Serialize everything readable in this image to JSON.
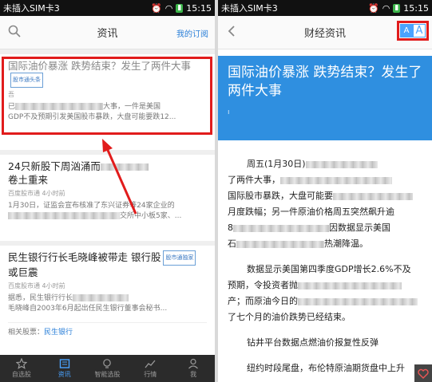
{
  "left": {
    "status": {
      "carrier": "未插入SIM卡3",
      "time": "15:15"
    },
    "header": {
      "title": "资讯",
      "subscribe_link": "我的订阅"
    },
    "articles": [
      {
        "title": "国际油价暴涨 跌势结束？发生了两件大事",
        "tag": "股市通头条",
        "meta": "吾",
        "summary_start": "已",
        "summary_mid": "大事，一件是美国",
        "summary_line2": "GDP不及预期引发美国股市暴跌，大盘可能要跌12..."
      },
      {
        "title_line1": "24只新股下周汹涌而",
        "title_line2": "卷土重来",
        "meta": "百度股市通  4小时前",
        "summary_line1": "1月30日，证监会宣布核准了东兴证券等24家企业的",
        "summary_line2": "交所中小板5家、..."
      },
      {
        "title_line1": "民生银行行长毛晓峰被带走 银行股",
        "tag": "股市通独家",
        "title_line2": "或巨震",
        "meta": "百度股市通  4小时前",
        "summary_line1": "据悉，民生银行行长",
        "summary_line2": "毛晓峰自2003年6月起出任民生银行董事会秘书...",
        "related_label": "相关股票：",
        "related_value": "民生银行"
      }
    ],
    "tabs": [
      "自选股",
      "资讯",
      "智能选股",
      "行情",
      "我"
    ]
  },
  "right": {
    "status": {
      "carrier": "未插入SIM卡3",
      "time": "15:15"
    },
    "header": {
      "title": "财经资讯"
    },
    "font_buttons": {
      "small": "A",
      "big": "A"
    },
    "article": {
      "title": "国际油价暴涨 跌势结束？发生了两件大事",
      "paragraphs": [
        {
          "start": "周五(1月30日)",
          "line2": "了两件大事，",
          "line3": "国际股市暴跌，大盘可能要",
          "line4": "月度跌幅；另一件原油价格周五突然飙升逾",
          "line5a": "8",
          "line5b": "因数据显示美国",
          "line6a": "石",
          "line6b": "热潮降温。"
        },
        {
          "line1": "数据显示美国第四季度GDP增长2.6%不及",
          "line2": "预期，令投资者抛",
          "line3": "产；而原油今日的",
          "line4": "了七个月的油价跌势已经结束。"
        },
        {
          "line1": "钻井平台数据点燃油价报复性反弹"
        },
        {
          "line1": "纽约时段尾盘，布伦特原油期货盘中上升"
        }
      ]
    }
  }
}
